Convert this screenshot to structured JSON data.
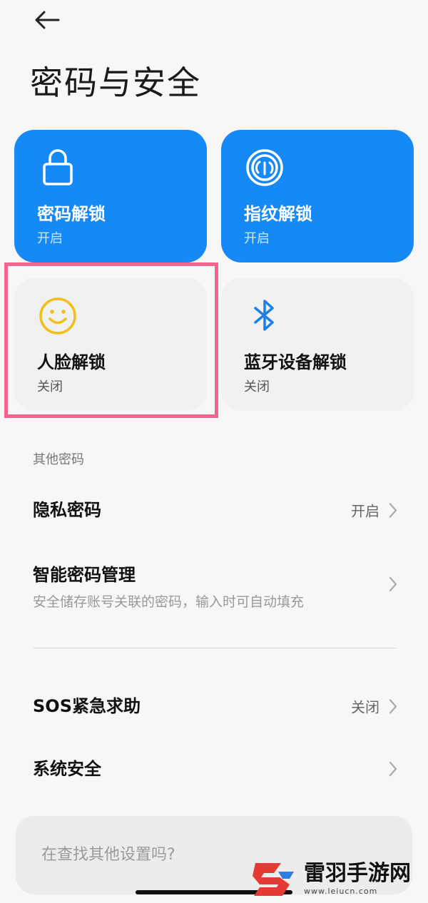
{
  "header": {
    "title": "密码与安全"
  },
  "tiles": [
    {
      "title": "密码解锁",
      "status": "开启"
    },
    {
      "title": "指纹解锁",
      "status": "开启"
    },
    {
      "title": "人脸解锁",
      "status": "关闭"
    },
    {
      "title": "蓝牙设备解锁",
      "status": "关闭"
    }
  ],
  "other_section": {
    "label": "其他密码",
    "privacy": {
      "title": "隐私密码",
      "status": "开启"
    },
    "smart": {
      "title": "智能密码管理",
      "subtitle": "安全储存账号关联的密码，输入时可自动填充"
    }
  },
  "sos": {
    "title": "SOS紧急求助",
    "status": "关闭"
  },
  "system_security": {
    "title": "系统安全"
  },
  "search": {
    "placeholder": "在查找其他设置吗?"
  },
  "watermark": {
    "brand": "雷羽手游网",
    "url": "www.leiucn.com"
  },
  "colors": {
    "accent_blue": "#1589f5",
    "face_icon_yellow": "#f1bf19",
    "bluetooth_blue": "#1e7fe6",
    "highlight_pink": "#f2658f"
  }
}
